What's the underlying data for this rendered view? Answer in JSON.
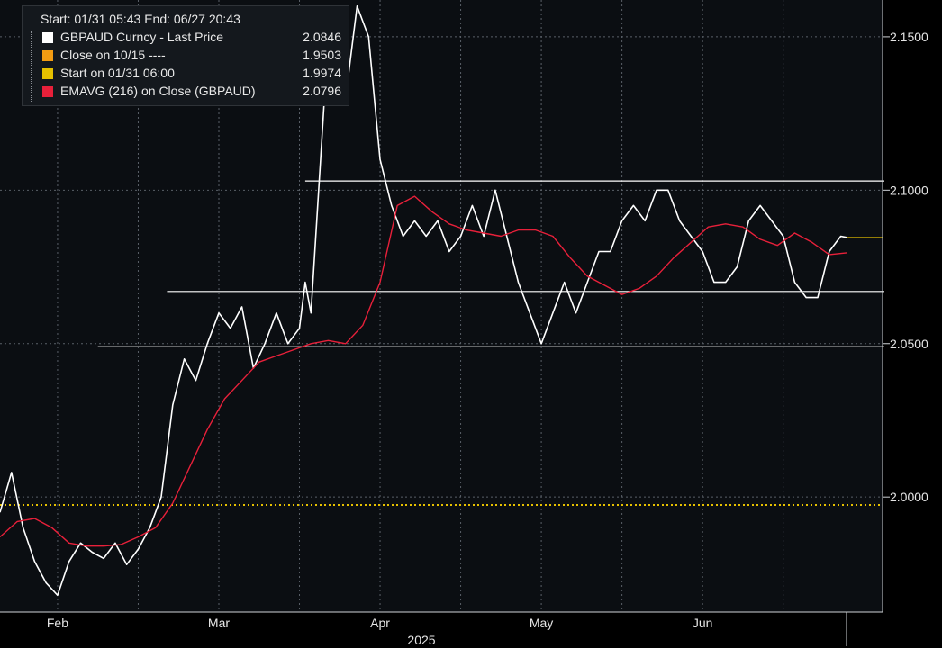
{
  "legend": {
    "start_label": "Start:",
    "start": "01/31 05:43",
    "end_label": "End:",
    "end": "06/27 20:43",
    "items": [
      {
        "label": "GBPAUD Curncy - Last Price",
        "value": "2.0846",
        "color": "#ffffff"
      },
      {
        "label": "Close on 10/15 ----",
        "value": "1.9503",
        "color": "#f39c12"
      },
      {
        "label": "Start on 01/31 06:00",
        "value": "1.9974",
        "color": "#e6c000"
      },
      {
        "label": "EMAVG (216)  on Close (GBPAUD)",
        "value": "2.0796",
        "color": "#e8203a"
      }
    ]
  },
  "chart_data": {
    "type": "line",
    "ylim": [
      1.9625,
      2.162
    ],
    "xlim": [
      "2025-01-31",
      "2025-06-27"
    ],
    "y_ticks": [
      "2.0000",
      "2.0500",
      "2.1000",
      "2.1500"
    ],
    "x_ticks": [
      {
        "label": "Feb",
        "date": "2025-02-10"
      },
      {
        "label": "Mar",
        "date": "2025-03-10"
      },
      {
        "label": "Apr",
        "date": "2025-04-07"
      },
      {
        "label": "May",
        "date": "2025-05-05"
      },
      {
        "label": "Jun",
        "date": "2025-06-02"
      }
    ],
    "x_year_label": "2025",
    "grid": true,
    "last_price_marker": 2.0846,
    "start_value_line": 1.9974,
    "horizontal_levels": [
      {
        "value": 2.103,
        "from": "2025-03-25",
        "to": "2025-06-27"
      },
      {
        "value": 2.067,
        "from": "2025-03-01",
        "to": "2025-06-27"
      },
      {
        "value": 2.049,
        "from": "2025-02-17",
        "to": "2025-06-27"
      }
    ],
    "series": [
      {
        "name": "GBPAUD Curncy - Last Price",
        "color": "#ffffff",
        "x": [
          "2025-01-31",
          "2025-02-02",
          "2025-02-04",
          "2025-02-06",
          "2025-02-08",
          "2025-02-10",
          "2025-02-12",
          "2025-02-14",
          "2025-02-16",
          "2025-02-18",
          "2025-02-20",
          "2025-02-22",
          "2025-02-24",
          "2025-02-26",
          "2025-02-28",
          "2025-03-02",
          "2025-03-04",
          "2025-03-06",
          "2025-03-08",
          "2025-03-10",
          "2025-03-12",
          "2025-03-14",
          "2025-03-16",
          "2025-03-18",
          "2025-03-20",
          "2025-03-22",
          "2025-03-24",
          "2025-03-25",
          "2025-03-26",
          "2025-03-27",
          "2025-03-28",
          "2025-03-29",
          "2025-03-30",
          "2025-04-01",
          "2025-04-03",
          "2025-04-05",
          "2025-04-07",
          "2025-04-09",
          "2025-04-11",
          "2025-04-13",
          "2025-04-15",
          "2025-04-17",
          "2025-04-19",
          "2025-04-21",
          "2025-04-23",
          "2025-04-25",
          "2025-04-27",
          "2025-04-29",
          "2025-05-01",
          "2025-05-03",
          "2025-05-05",
          "2025-05-07",
          "2025-05-09",
          "2025-05-11",
          "2025-05-13",
          "2025-05-15",
          "2025-05-17",
          "2025-05-19",
          "2025-05-21",
          "2025-05-23",
          "2025-05-25",
          "2025-05-27",
          "2025-05-29",
          "2025-05-31",
          "2025-06-02",
          "2025-06-04",
          "2025-06-06",
          "2025-06-08",
          "2025-06-10",
          "2025-06-12",
          "2025-06-14",
          "2025-06-16",
          "2025-06-18",
          "2025-06-20",
          "2025-06-22",
          "2025-06-24",
          "2025-06-26",
          "2025-06-27"
        ],
        "values": [
          1.995,
          2.008,
          1.99,
          1.979,
          1.972,
          1.968,
          1.979,
          1.985,
          1.982,
          1.98,
          1.985,
          1.978,
          1.983,
          1.99,
          2.0,
          2.03,
          2.045,
          2.038,
          2.05,
          2.06,
          2.055,
          2.062,
          2.042,
          2.05,
          2.06,
          2.05,
          2.055,
          2.07,
          2.06,
          2.09,
          2.12,
          2.15,
          2.14,
          2.13,
          2.16,
          2.15,
          2.11,
          2.095,
          2.085,
          2.09,
          2.085,
          2.09,
          2.08,
          2.085,
          2.095,
          2.085,
          2.1,
          2.085,
          2.07,
          2.06,
          2.05,
          2.06,
          2.07,
          2.06,
          2.07,
          2.08,
          2.08,
          2.09,
          2.095,
          2.09,
          2.1,
          2.1,
          2.09,
          2.085,
          2.08,
          2.07,
          2.07,
          2.075,
          2.09,
          2.095,
          2.09,
          2.085,
          2.07,
          2.065,
          2.065,
          2.08,
          2.085,
          2.0846
        ]
      },
      {
        "name": "EMAVG (216)  on Close (GBPAUD)",
        "color": "#e8203a",
        "x": [
          "2025-01-31",
          "2025-02-03",
          "2025-02-06",
          "2025-02-09",
          "2025-02-12",
          "2025-02-15",
          "2025-02-18",
          "2025-02-21",
          "2025-02-24",
          "2025-02-27",
          "2025-03-02",
          "2025-03-05",
          "2025-03-08",
          "2025-03-11",
          "2025-03-14",
          "2025-03-17",
          "2025-03-20",
          "2025-03-23",
          "2025-03-26",
          "2025-03-29",
          "2025-04-01",
          "2025-04-04",
          "2025-04-07",
          "2025-04-10",
          "2025-04-13",
          "2025-04-16",
          "2025-04-19",
          "2025-04-22",
          "2025-04-25",
          "2025-04-28",
          "2025-05-01",
          "2025-05-04",
          "2025-05-07",
          "2025-05-10",
          "2025-05-13",
          "2025-05-16",
          "2025-05-19",
          "2025-05-22",
          "2025-05-25",
          "2025-05-28",
          "2025-05-31",
          "2025-06-03",
          "2025-06-06",
          "2025-06-09",
          "2025-06-12",
          "2025-06-15",
          "2025-06-18",
          "2025-06-21",
          "2025-06-24",
          "2025-06-27"
        ],
        "values": [
          1.987,
          1.992,
          1.993,
          1.99,
          1.985,
          1.984,
          1.984,
          1.9845,
          1.987,
          1.99,
          1.998,
          2.01,
          2.022,
          2.032,
          2.038,
          2.044,
          2.046,
          2.048,
          2.05,
          2.051,
          2.05,
          2.056,
          2.07,
          2.095,
          2.098,
          2.093,
          2.089,
          2.087,
          2.086,
          2.085,
          2.087,
          2.087,
          2.085,
          2.078,
          2.072,
          2.069,
          2.066,
          2.068,
          2.072,
          2.078,
          2.083,
          2.088,
          2.089,
          2.088,
          2.084,
          2.082,
          2.086,
          2.083,
          2.079,
          2.0796
        ]
      }
    ]
  }
}
